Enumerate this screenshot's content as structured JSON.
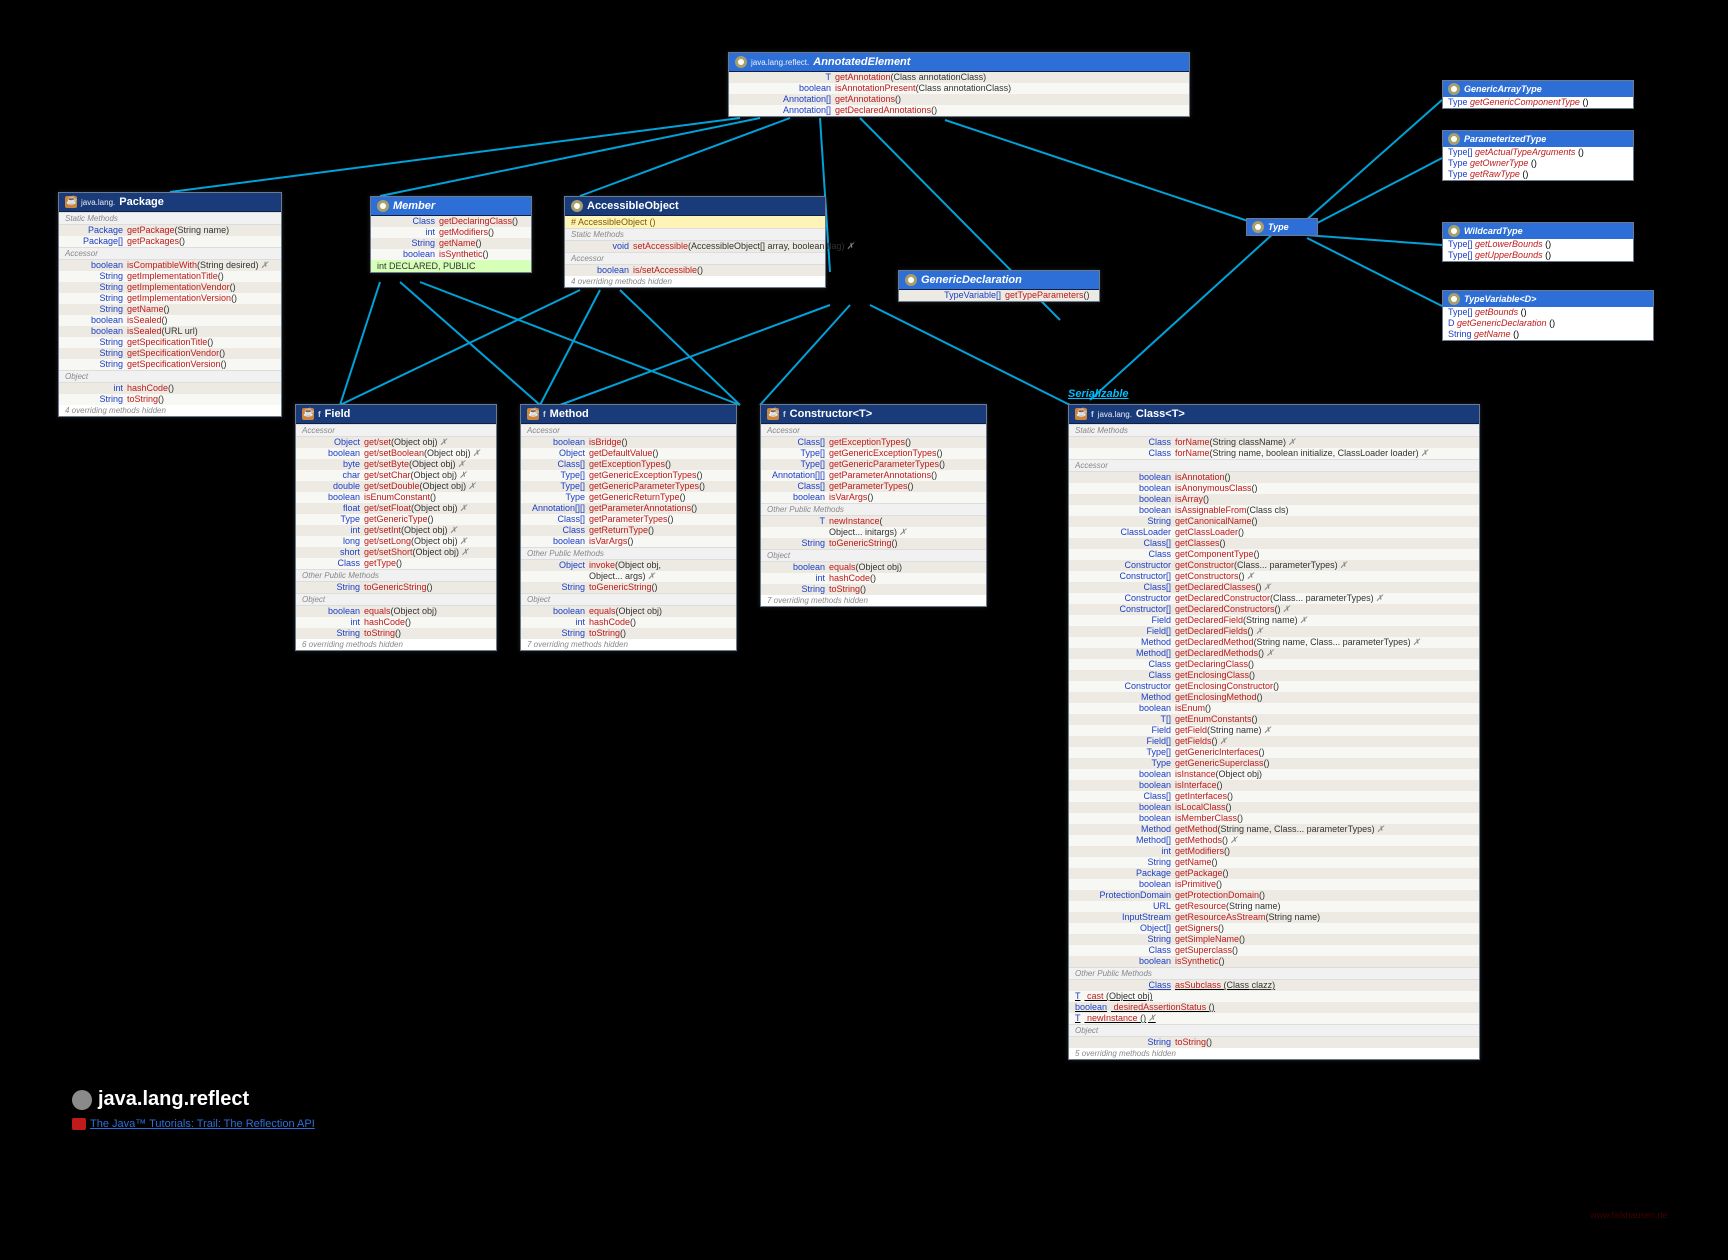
{
  "title": {
    "package_name": "java.lang.reflect",
    "tutorial_link": "The Java™ Tutorials: Trail: The Reflection API"
  },
  "serializable_label": "Serializable",
  "watermark": "www.falkhausen.de",
  "annotated_element": {
    "pkg": "java.lang.reflect.",
    "name": "AnnotatedElement",
    "methods": [
      {
        "type": "<T extends Annotation> T",
        "name": "getAnnotation",
        "params": "(Class<T> annotationClass)"
      },
      {
        "type": "boolean",
        "name": "isAnnotationPresent",
        "params": "(Class<? extends Annotation> annotationClass)"
      },
      {
        "type": "Annotation[]",
        "name": "getAnnotations",
        "params": "()"
      },
      {
        "type": "Annotation[]",
        "name": "getDeclaredAnnotations",
        "params": "()"
      }
    ]
  },
  "package_box": {
    "pkg": "java.lang.",
    "name": "Package",
    "sections": {
      "static": [
        {
          "type": "Package",
          "name": "getPackage",
          "params": "(String name)"
        },
        {
          "type": "Package[]",
          "name": "getPackages",
          "params": "()"
        }
      ],
      "accessor": [
        {
          "type": "boolean",
          "name": "isCompatibleWith",
          "params": "(String desired)",
          "throws": true
        },
        {
          "type": "String",
          "name": "getImplementationTitle",
          "params": "()"
        },
        {
          "type": "String",
          "name": "getImplementationVendor",
          "params": "()"
        },
        {
          "type": "String",
          "name": "getImplementationVersion",
          "params": "()"
        },
        {
          "type": "String",
          "name": "getName",
          "params": "()"
        },
        {
          "type": "boolean",
          "name": "isSealed",
          "params": "()"
        },
        {
          "type": "boolean",
          "name": "isSealed",
          "params": "(URL url)"
        },
        {
          "type": "String",
          "name": "getSpecificationTitle",
          "params": "()"
        },
        {
          "type": "String",
          "name": "getSpecificationVendor",
          "params": "()"
        },
        {
          "type": "String",
          "name": "getSpecificationVersion",
          "params": "()"
        }
      ],
      "object": [
        {
          "type": "int",
          "name": "hashCode",
          "params": "()"
        },
        {
          "type": "String",
          "name": "toString",
          "params": "()"
        }
      ]
    },
    "footer": "4 overriding methods hidden"
  },
  "member": {
    "name": "Member",
    "methods": [
      {
        "type": "Class<?>",
        "name": "getDeclaringClass",
        "params": "()"
      },
      {
        "type": "int",
        "name": "getModifiers",
        "params": "()"
      },
      {
        "type": "String",
        "name": "getName",
        "params": "()"
      },
      {
        "type": "boolean",
        "name": "isSynthetic",
        "params": "()"
      }
    ],
    "constants": "int DECLARED, PUBLIC"
  },
  "accessible_object": {
    "name": "AccessibleObject",
    "constructor": "# AccessibleObject ()",
    "sections": {
      "static": [
        {
          "type": "void",
          "name": "setAccessible",
          "params": "(AccessibleObject[] array, boolean flag)",
          "throws": true
        }
      ],
      "accessor": [
        {
          "type": "boolean",
          "name": "is/setAccessible",
          "params": "()"
        }
      ]
    },
    "footer": "4 overriding methods hidden"
  },
  "generic_declaration": {
    "name": "GenericDeclaration",
    "methods": [
      {
        "type": "TypeVariable<?>[]",
        "name": "getTypeParameters",
        "params": "()"
      }
    ]
  },
  "type_box": {
    "name": "Type"
  },
  "generic_array_type": {
    "name": "GenericArrayType",
    "methods": [
      {
        "type": "Type",
        "name": "getGenericComponentType",
        "params": "()"
      }
    ]
  },
  "parameterized_type": {
    "name": "ParameterizedType",
    "methods": [
      {
        "type": "Type[]",
        "name": "getActualTypeArguments",
        "params": "()"
      },
      {
        "type": "Type",
        "name": "getOwnerType",
        "params": "()"
      },
      {
        "type": "Type",
        "name": "getRawType",
        "params": "()"
      }
    ]
  },
  "wildcard_type": {
    "name": "WildcardType",
    "methods": [
      {
        "type": "Type[]",
        "name": "getLowerBounds",
        "params": "()"
      },
      {
        "type": "Type[]",
        "name": "getUpperBounds",
        "params": "()"
      }
    ]
  },
  "type_variable": {
    "name": "TypeVariable<D>",
    "methods": [
      {
        "type": "Type[]",
        "name": "getBounds",
        "params": "()"
      },
      {
        "type": "D",
        "name": "getGenericDeclaration",
        "params": "()"
      },
      {
        "type": "String",
        "name": "getName",
        "params": "()"
      }
    ]
  },
  "field": {
    "name": "Field",
    "accessor": [
      {
        "type": "Object",
        "name": "get/set",
        "params": "(Object obj)",
        "throws": true
      },
      {
        "type": "boolean",
        "name": "get/setBoolean",
        "params": "(Object obj)",
        "throws": true
      },
      {
        "type": "byte",
        "name": "get/setByte",
        "params": "(Object obj)",
        "throws": true
      },
      {
        "type": "char",
        "name": "get/setChar",
        "params": "(Object obj)",
        "throws": true
      },
      {
        "type": "double",
        "name": "get/setDouble",
        "params": "(Object obj)",
        "throws": true
      },
      {
        "type": "boolean",
        "name": "isEnumConstant",
        "params": "()"
      },
      {
        "type": "float",
        "name": "get/setFloat",
        "params": "(Object obj)",
        "throws": true
      },
      {
        "type": "Type",
        "name": "getGenericType",
        "params": "()"
      },
      {
        "type": "int",
        "name": "get/setInt",
        "params": "(Object obj)",
        "throws": true
      },
      {
        "type": "long",
        "name": "get/setLong",
        "params": "(Object obj)",
        "throws": true
      },
      {
        "type": "short",
        "name": "get/setShort",
        "params": "(Object obj)",
        "throws": true
      },
      {
        "type": "Class<?>",
        "name": "getType",
        "params": "()"
      }
    ],
    "other": [
      {
        "type": "String",
        "name": "toGenericString",
        "params": "()"
      }
    ],
    "object": [
      {
        "type": "boolean",
        "name": "equals",
        "params": "(Object obj)"
      },
      {
        "type": "int",
        "name": "hashCode",
        "params": "()"
      },
      {
        "type": "String",
        "name": "toString",
        "params": "()"
      }
    ],
    "footer": "6 overriding methods hidden"
  },
  "method": {
    "name": "Method",
    "accessor": [
      {
        "type": "boolean",
        "name": "isBridge",
        "params": "()"
      },
      {
        "type": "Object",
        "name": "getDefaultValue",
        "params": "()"
      },
      {
        "type": "Class<?>[]",
        "name": "getExceptionTypes",
        "params": "()"
      },
      {
        "type": "Type[]",
        "name": "getGenericExceptionTypes",
        "params": "()"
      },
      {
        "type": "Type[]",
        "name": "getGenericParameterTypes",
        "params": "()"
      },
      {
        "type": "Type",
        "name": "getGenericReturnType",
        "params": "()"
      },
      {
        "type": "Annotation[][]",
        "name": "getParameterAnnotations",
        "params": "()"
      },
      {
        "type": "Class<?>[]",
        "name": "getParameterTypes",
        "params": "()"
      },
      {
        "type": "Class<?>",
        "name": "getReturnType",
        "params": "()"
      },
      {
        "type": "boolean",
        "name": "isVarArgs",
        "params": "()"
      }
    ],
    "other": [
      {
        "type": "Object",
        "name": "invoke",
        "params": "(Object obj,"
      },
      {
        "type": "",
        "name": "",
        "params": "        Object... args)",
        "throws": true
      },
      {
        "type": "String",
        "name": "toGenericString",
        "params": "()"
      }
    ],
    "object": [
      {
        "type": "boolean",
        "name": "equals",
        "params": "(Object obj)"
      },
      {
        "type": "int",
        "name": "hashCode",
        "params": "()"
      },
      {
        "type": "String",
        "name": "toString",
        "params": "()"
      }
    ],
    "footer": "7 overriding methods hidden"
  },
  "constructor": {
    "name": "Constructor<T>",
    "accessor": [
      {
        "type": "Class<?>[]",
        "name": "getExceptionTypes",
        "params": "()"
      },
      {
        "type": "Type[]",
        "name": "getGenericExceptionTypes",
        "params": "()"
      },
      {
        "type": "Type[]",
        "name": "getGenericParameterTypes",
        "params": "()"
      },
      {
        "type": "Annotation[][]",
        "name": "getParameterAnnotations",
        "params": "()"
      },
      {
        "type": "Class<?>[]",
        "name": "getParameterTypes",
        "params": "()"
      },
      {
        "type": "boolean",
        "name": "isVarArgs",
        "params": "()"
      }
    ],
    "other": [
      {
        "type": "T",
        "name": "newInstance",
        "params": "("
      },
      {
        "type": "",
        "name": "",
        "params": "        Object... initargs)",
        "throws": true
      },
      {
        "type": "String",
        "name": "toGenericString",
        "params": "()"
      }
    ],
    "object": [
      {
        "type": "boolean",
        "name": "equals",
        "params": "(Object obj)"
      },
      {
        "type": "int",
        "name": "hashCode",
        "params": "()"
      },
      {
        "type": "String",
        "name": "toString",
        "params": "()"
      }
    ],
    "footer": "7 overriding methods hidden"
  },
  "class_box": {
    "pkg": "java.lang.",
    "name": "Class<T>",
    "static": [
      {
        "type": "Class<?>",
        "name": "forName",
        "params": "(String className)",
        "throws": true
      },
      {
        "type": "Class<?>",
        "name": "forName",
        "params": "(String name, boolean initialize, ClassLoader loader)",
        "throws": true
      }
    ],
    "accessor": [
      {
        "type": "boolean",
        "name": "isAnnotation",
        "params": "()"
      },
      {
        "type": "boolean",
        "name": "isAnonymousClass",
        "params": "()"
      },
      {
        "type": "boolean",
        "name": "isArray",
        "params": "()"
      },
      {
        "type": "boolean",
        "name": "isAssignableFrom",
        "params": "(Class<?> cls)"
      },
      {
        "type": "String",
        "name": "getCanonicalName",
        "params": "()"
      },
      {
        "type": "ClassLoader",
        "name": "getClassLoader",
        "params": "()"
      },
      {
        "type": "Class<?>[]",
        "name": "getClasses",
        "params": "()"
      },
      {
        "type": "Class<?>",
        "name": "getComponentType",
        "params": "()"
      },
      {
        "type": "Constructor<T>",
        "name": "getConstructor",
        "params": "(Class<?>... parameterTypes)",
        "throws": true
      },
      {
        "type": "Constructor<?>[]",
        "name": "getConstructors",
        "params": "()",
        "throws": true
      },
      {
        "type": "Class<?>[]",
        "name": "getDeclaredClasses",
        "params": "()",
        "throws": true
      },
      {
        "type": "Constructor<T>",
        "name": "getDeclaredConstructor",
        "params": "(Class<?>... parameterTypes)",
        "throws": true
      },
      {
        "type": "Constructor<?>[]",
        "name": "getDeclaredConstructors",
        "params": "()",
        "throws": true
      },
      {
        "type": "Field",
        "name": "getDeclaredField",
        "params": "(String name)",
        "throws": true
      },
      {
        "type": "Field[]",
        "name": "getDeclaredFields",
        "params": "()",
        "throws": true
      },
      {
        "type": "Method",
        "name": "getDeclaredMethod",
        "params": "(String name, Class<?>... parameterTypes)",
        "throws": true
      },
      {
        "type": "Method[]",
        "name": "getDeclaredMethods",
        "params": "()",
        "throws": true
      },
      {
        "type": "Class<?>",
        "name": "getDeclaringClass",
        "params": "()"
      },
      {
        "type": "Class<?>",
        "name": "getEnclosingClass",
        "params": "()"
      },
      {
        "type": "Constructor<?>",
        "name": "getEnclosingConstructor",
        "params": "()"
      },
      {
        "type": "Method",
        "name": "getEnclosingMethod",
        "params": "()"
      },
      {
        "type": "boolean",
        "name": "isEnum",
        "params": "()"
      },
      {
        "type": "T[]",
        "name": "getEnumConstants",
        "params": "()"
      },
      {
        "type": "Field",
        "name": "getField",
        "params": "(String name)",
        "throws": true
      },
      {
        "type": "Field[]",
        "name": "getFields",
        "params": "()",
        "throws": true
      },
      {
        "type": "Type[]",
        "name": "getGenericInterfaces",
        "params": "()"
      },
      {
        "type": "Type",
        "name": "getGenericSuperclass",
        "params": "()"
      },
      {
        "type": "boolean",
        "name": "isInstance",
        "params": "(Object obj)"
      },
      {
        "type": "boolean",
        "name": "isInterface",
        "params": "()"
      },
      {
        "type": "Class<?>[]",
        "name": "getInterfaces",
        "params": "()"
      },
      {
        "type": "boolean",
        "name": "isLocalClass",
        "params": "()"
      },
      {
        "type": "boolean",
        "name": "isMemberClass",
        "params": "()"
      },
      {
        "type": "Method",
        "name": "getMethod",
        "params": "(String name, Class<?>... parameterTypes)",
        "throws": true
      },
      {
        "type": "Method[]",
        "name": "getMethods",
        "params": "()",
        "throws": true
      },
      {
        "type": "int",
        "name": "getModifiers",
        "params": "()"
      },
      {
        "type": "String",
        "name": "getName",
        "params": "()"
      },
      {
        "type": "Package",
        "name": "getPackage",
        "params": "()"
      },
      {
        "type": "boolean",
        "name": "isPrimitive",
        "params": "()"
      },
      {
        "type": "ProtectionDomain",
        "name": "getProtectionDomain",
        "params": "()"
      },
      {
        "type": "URL",
        "name": "getResource",
        "params": "(String name)"
      },
      {
        "type": "InputStream",
        "name": "getResourceAsStream",
        "params": "(String name)"
      },
      {
        "type": "Object[]",
        "name": "getSigners",
        "params": "()"
      },
      {
        "type": "String",
        "name": "getSimpleName",
        "params": "()"
      },
      {
        "type": "Class<? super T>",
        "name": "getSuperclass",
        "params": "()"
      },
      {
        "type": "boolean",
        "name": "isSynthetic",
        "params": "()"
      }
    ],
    "other": [
      {
        "type": "<U> Class<? extends U>",
        "name": "asSubclass",
        "params": "(Class<U> clazz)"
      },
      {
        "type": "T",
        "name": "cast",
        "params": "(Object obj)"
      },
      {
        "type": "boolean",
        "name": "desiredAssertionStatus",
        "params": "()"
      },
      {
        "type": "T",
        "name": "newInstance",
        "params": "()",
        "throws": true
      }
    ],
    "object": [
      {
        "type": "String",
        "name": "toString",
        "params": "()"
      }
    ],
    "footer": "5 overriding methods hidden"
  },
  "labels": {
    "static_methods": "Static Methods",
    "accessor": "Accessor",
    "object": "Object",
    "other_public": "Other Public Methods"
  }
}
